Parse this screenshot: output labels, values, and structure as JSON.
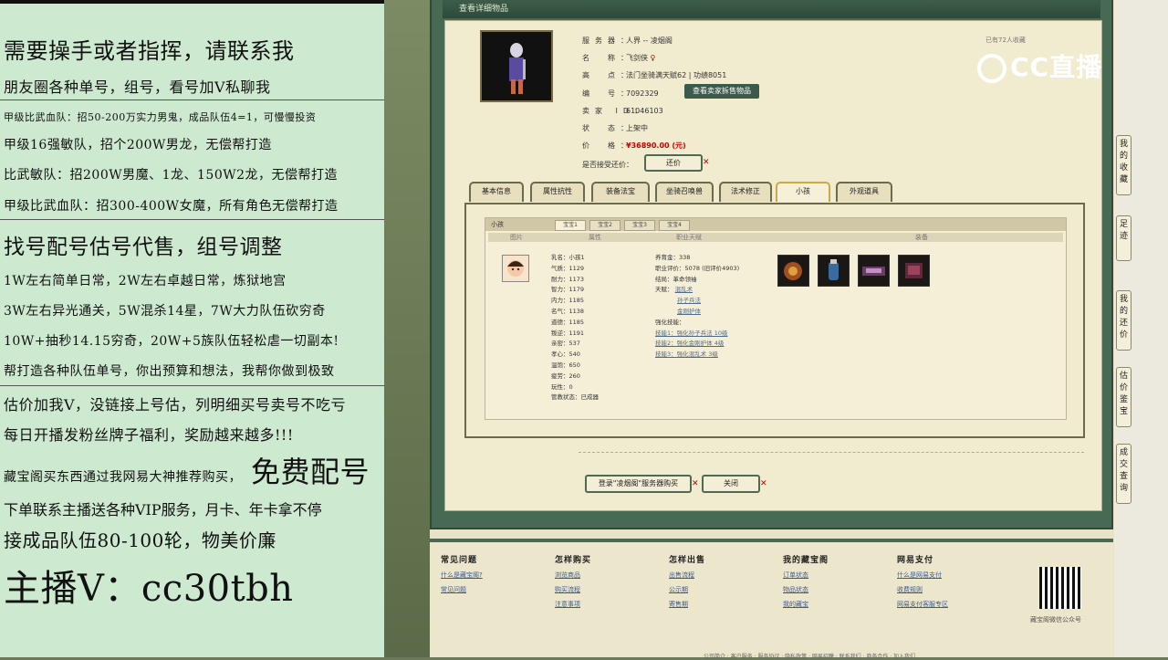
{
  "left_panel": {
    "lines": [
      "需要操手或者指挥，请联系我",
      "朋友圈各种单号，组号，看号加Ⅴ私聊我",
      "甲级比武血队：招50-200万实力男鬼，成品队伍4=1，可慢慢投资",
      "甲级16强敏队，招个200W男龙，无偿帮打造",
      "比武敏队：招200W男魔、1龙、150W2龙，无偿帮打造",
      "甲级比武血队：招300-400W女魔，所有角色无偿帮打造",
      "找号配号估号代售，组号调整",
      "1W左右简单日常，2W左右卓越日常，炼狱地宫",
      "3W左右异光通关，5W混杀14星，7W大力队伍砍穷奇",
      "10W+抽秒14.15穷奇，20W+5族队伍轻松虐一切副本!",
      "帮打造各种队伍单号，你出预算和想法，我帮你做到极致",
      "估价加我Ⅴ，没链接上号估，列明细买号卖号不吃亏",
      "每日开播发粉丝牌子福利，奖励越来越多!!!",
      "藏宝阁买东西通过我网易大神推荐购买，",
      "免费配号",
      "下单联系主播送各种VIP服务，月卡、年卡拿不停",
      "接成品队伍80-100轮，物美价廉",
      "主播Ⅴ：cc30tbh"
    ]
  },
  "window": {
    "title": "查看详细物品",
    "collect": "已有72人收藏"
  },
  "item": {
    "server_label": "服务器：",
    "server": "人界 -- 凌烟阁",
    "name_label": "名　称：",
    "name": "飞剑侠",
    "point_label": "高　点：",
    "point": "法门坐骑满天赋62 | 功绩8051",
    "num_label": "编　号：",
    "num": "7092329",
    "seller_label": "卖家 ID：",
    "seller": "61046103",
    "status_label": "状　态：",
    "status": "上架中",
    "price_label": "价　格：",
    "price": "¥36890.00 (元)",
    "bargain_label": "是否接受还价：",
    "seller_btn": "查看卖家拆售物品",
    "bargain_btn": "还价"
  },
  "tabs": [
    "基本信息",
    "属性抗性",
    "装备法宝",
    "坐骑召唤兽",
    "法术修正",
    "小孩",
    "外观道具"
  ],
  "child_section": {
    "title": "小孩",
    "subtabs": [
      "宝宝1",
      "宝宝2",
      "宝宝3",
      "宝宝4"
    ],
    "columns": [
      "图片",
      "属性",
      "职业天赋",
      "装备"
    ],
    "stats": [
      "乳名：小孩1",
      "气质：1129",
      "耐力：1173",
      "智力：1179",
      "内力：1185",
      "名气：1138",
      "道德：1185",
      "叛逆：1191",
      "亲密：537",
      "孝心：540",
      "温饱：650",
      "疲劳：260",
      "玩性：0",
      "管教状态：已成器"
    ],
    "career": [
      "养育金：338",
      "职业评价：5078 (旧评价4903)",
      "结局：革命领袖",
      "天赋：",
      "强化技能："
    ],
    "talents": [
      "混乱术",
      "孙子兵法",
      "金刚护体"
    ],
    "skills": [
      "技能1：强化孙子兵法 10级",
      "技能2：强化金刚护体 4级",
      "技能3：强化混乱术 3级"
    ]
  },
  "actions": {
    "login": "登录\"凌烟阁\"服务器购买",
    "close": "关闭"
  },
  "footer": {
    "cols": [
      {
        "h": "常见问题",
        "links": [
          "什么是藏宝阁?",
          "常见问题"
        ]
      },
      {
        "h": "怎样购买",
        "links": [
          "浏览商品",
          "购买流程",
          "注意事项"
        ]
      },
      {
        "h": "怎样出售",
        "links": [
          "出售流程",
          "公示期",
          "寄售期"
        ]
      },
      {
        "h": "我的藏宝阁",
        "links": [
          "订单状态",
          "物品状态",
          "我的藏宝"
        ]
      },
      {
        "h": "网易支付",
        "links": [
          "什么是网易支付",
          "收费规则",
          "网易支付客服专区"
        ]
      }
    ],
    "qr_caption": "藏宝阁微信公众号",
    "bottom": "公司简介 · 客户服务 · 服务协议 · 隐私政策 · 网易招聘 · 联系我们 · 商务合作 · 加入我们"
  },
  "side_buttons": [
    "我的收藏",
    "足迹",
    "我的还价",
    "估价鉴宝",
    "成交查询"
  ],
  "overlay": {
    "logo": "CC直播"
  }
}
